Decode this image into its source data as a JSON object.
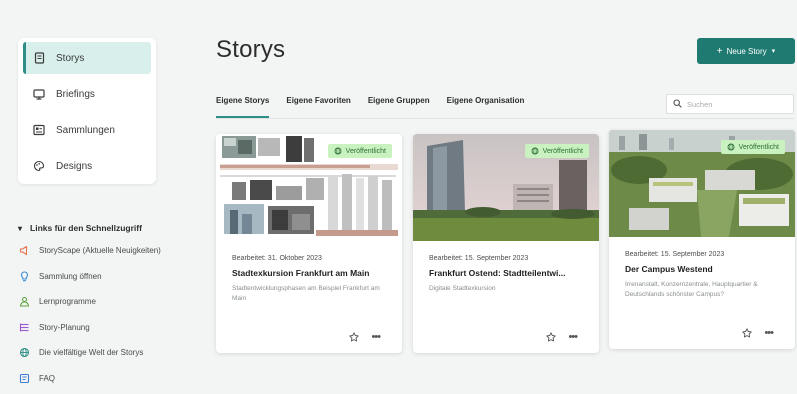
{
  "sidebar": {
    "items": [
      {
        "label": "Storys",
        "icon": "book-icon",
        "active": true
      },
      {
        "label": "Briefings",
        "icon": "monitor-icon",
        "active": false
      },
      {
        "label": "Sammlungen",
        "icon": "collection-icon",
        "active": false
      },
      {
        "label": "Designs",
        "icon": "palette-icon",
        "active": false
      }
    ],
    "quick_links_title": "Links für den Schnellzugriff",
    "quick_links": [
      {
        "label": "StoryScape (Aktuelle Neuigkeiten)",
        "icon": "megaphone-icon",
        "color": "#e8734f"
      },
      {
        "label": "Sammlung öffnen",
        "icon": "lightbulb-icon",
        "color": "#3c8fd6"
      },
      {
        "label": "Lernprogramme",
        "icon": "student-icon",
        "color": "#5aa53c"
      },
      {
        "label": "Story-Planung",
        "icon": "list-icon",
        "color": "#9b59d0"
      },
      {
        "label": "Die vielfältige Welt der Storys",
        "icon": "globe-icon",
        "color": "#2f8f86"
      },
      {
        "label": "FAQ",
        "icon": "faq-icon",
        "color": "#3c7ed6"
      }
    ]
  },
  "header": {
    "title": "Storys",
    "new_button_label": "Neue Story"
  },
  "tabs": [
    "Eigene Storys",
    "Eigene Favoriten",
    "Eigene Gruppen",
    "Eigene Organisation"
  ],
  "search": {
    "placeholder": "Suchen"
  },
  "cards": [
    {
      "badge": "Veröffentlicht",
      "meta": "Bearbeitet: 31. Oktober 2023",
      "title": "Stadtexkursion Frankfurt am Main",
      "description": "Stadtentwicklungsphasen am Beispiel Frankfurt am Main"
    },
    {
      "badge": "Veröffentlicht",
      "meta": "Bearbeitet: 15. September 2023",
      "title": "Frankfurt Ostend: Stadtteilentwi...",
      "description": "Digitale Stadtexkursion"
    },
    {
      "badge": "Veröffentlicht",
      "meta": "Bearbeitet: 15. September 2023",
      "title": "Der Campus Westend",
      "description": "Irrenanstalt, Konzernzentrale, Hauptquartier & Deutschlands schönster Campus?"
    }
  ],
  "colors": {
    "accent": "#2f8f86",
    "button": "#1f7a72",
    "badge_bg": "#c9f2c0",
    "active_nav_bg": "#d9efec"
  }
}
